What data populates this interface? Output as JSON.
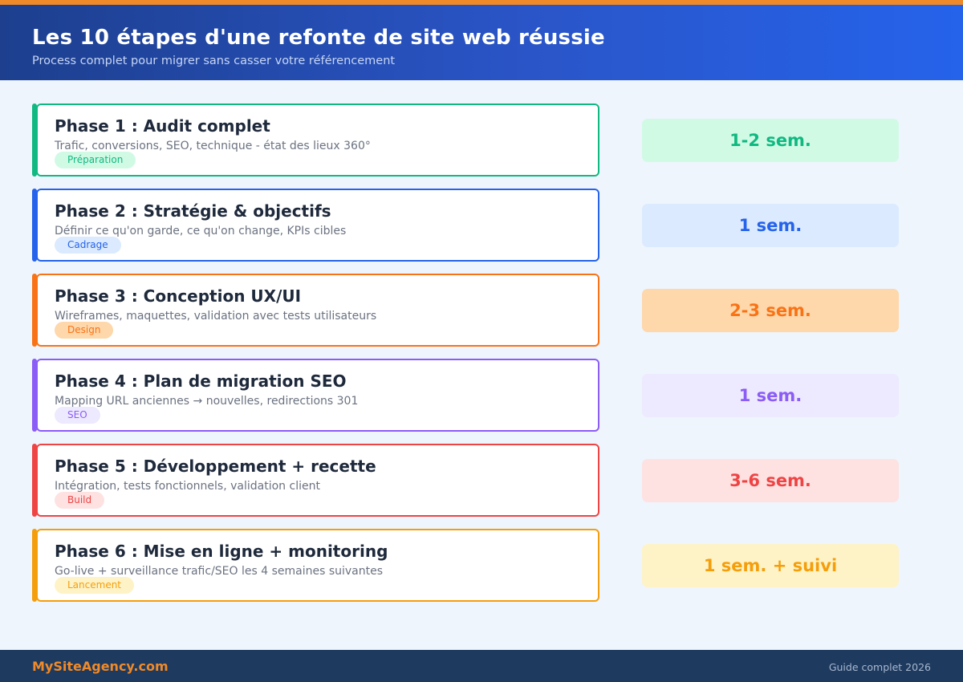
{
  "header": {
    "title": "Les 10 étapes d'une refonte de site web réussie",
    "subtitle": "Process complet pour migrer sans casser votre référencement"
  },
  "phases": [
    {
      "title": "Phase 1 : Audit complet",
      "description": "Trafic, conversions, SEO, technique - état des lieux 360°",
      "tag": "Préparation",
      "duration": "1-2 sem.",
      "color": "#10b981",
      "tag_bg": "#d1fae5",
      "dur_bg": "#d1fae5"
    },
    {
      "title": "Phase 2 : Stratégie & objectifs",
      "description": "Définir ce qu'on garde, ce qu'on change, KPIs cibles",
      "tag": "Cadrage",
      "duration": "1 sem.",
      "color": "#2563eb",
      "tag_bg": "#dbeafe",
      "dur_bg": "#dbeafe"
    },
    {
      "title": "Phase 3 : Conception UX/UI",
      "description": "Wireframes, maquettes, validation avec tests utilisateurs",
      "tag": "Design",
      "duration": "2-3 sem.",
      "color": "#f97316",
      "tag_bg": "#fed7aa",
      "dur_bg": "#fed7aa"
    },
    {
      "title": "Phase 4 : Plan de migration SEO",
      "description": "Mapping URL anciennes → nouvelles, redirections 301",
      "tag": "SEO",
      "duration": "1 sem.",
      "color": "#8b5cf6",
      "tag_bg": "#ede9fe",
      "dur_bg": "#ede9fe"
    },
    {
      "title": "Phase 5 : Développement + recette",
      "description": "Intégration, tests fonctionnels, validation client",
      "tag": "Build",
      "duration": "3-6 sem.",
      "color": "#ef4444",
      "tag_bg": "#fee2e2",
      "dur_bg": "#fee2e2"
    },
    {
      "title": "Phase 6 : Mise en ligne + monitoring",
      "description": "Go-live + surveillance trafic/SEO les 4 semaines suivantes",
      "tag": "Lancement",
      "duration": "1 sem. + suivi",
      "color": "#f59e0b",
      "tag_bg": "#fef3c7",
      "dur_bg": "#fef3c7"
    }
  ],
  "footer": {
    "brand": "MySiteAgency.com",
    "note": "Guide complet 2026"
  },
  "colors": {
    "header_start": "#1d3f8e",
    "header_end": "#2563eb",
    "accent_orange": "#f08a28",
    "footer_bg": "#1e3a5f",
    "page_bg": "#eef5fd"
  }
}
